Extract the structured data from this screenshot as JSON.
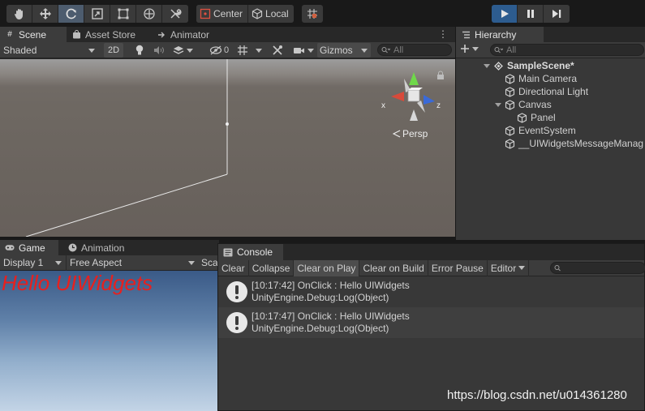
{
  "toolbar": {
    "tools": [
      "hand-tool",
      "move-tool",
      "rotate-tool",
      "scale-tool",
      "rect-tool",
      "transform-tool",
      "custom-tool"
    ],
    "pivot_label": "Center",
    "space_label": "Local",
    "snap_icon": "grid-snap-icon",
    "play_icon": "play-icon",
    "pause_icon": "pause-icon",
    "step_icon": "step-icon",
    "colors": {
      "active_tool": "#4d5c6e",
      "play_active": "#2d5c8f"
    }
  },
  "scene_panel": {
    "tabs": [
      {
        "label": "Scene",
        "icon": "hash-icon",
        "active": true
      },
      {
        "label": "Asset Store",
        "icon": "shopping-bag-icon",
        "active": false
      },
      {
        "label": "Animator",
        "icon": "animator-icon",
        "active": false
      }
    ],
    "toolbar": {
      "shading_mode": "Shaded",
      "mode_2d_label": "2D",
      "hidden_count": "0",
      "gizmos_label": "Gizmos",
      "search_placeholder": "All"
    },
    "gizmo": {
      "x_label": "x",
      "z_label": "z",
      "projection_label": "Persp"
    }
  },
  "hierarchy": {
    "tab_label": "Hierarchy",
    "search_placeholder": "All",
    "items": [
      {
        "label": "SampleScene*",
        "depth": 0,
        "type": "scene"
      },
      {
        "label": "Main Camera",
        "depth": 1,
        "type": "object"
      },
      {
        "label": "Directional Light",
        "depth": 1,
        "type": "object"
      },
      {
        "label": "Canvas",
        "depth": 1,
        "type": "object"
      },
      {
        "label": "Panel",
        "depth": 2,
        "type": "object"
      },
      {
        "label": "EventSystem",
        "depth": 1,
        "type": "object"
      },
      {
        "label": "__UIWidgetsMessageManag",
        "depth": 1,
        "type": "object"
      }
    ]
  },
  "game_panel": {
    "tabs": [
      {
        "label": "Game",
        "icon": "gamepad-icon",
        "active": true
      },
      {
        "label": "Animation",
        "icon": "clock-icon",
        "active": false
      }
    ],
    "display_label": "Display 1",
    "aspect_label": "Free Aspect",
    "scale_label": "Sca",
    "hello_text": "Hello UIWidgets",
    "hello_color": "#e8201e"
  },
  "console": {
    "tab_label": "Console",
    "buttons": [
      "Clear",
      "Collapse",
      "Clear on Play",
      "Clear on Build",
      "Error Pause"
    ],
    "editor_label": "Editor",
    "entries": [
      {
        "line1": "[10:17:42] OnClick : Hello UIWidgets",
        "line2": "UnityEngine.Debug:Log(Object)"
      },
      {
        "line1": "[10:17:47] OnClick : Hello UIWidgets",
        "line2": "UnityEngine.Debug:Log(Object)"
      }
    ]
  },
  "watermark": "https://blog.csdn.net/u014361280"
}
